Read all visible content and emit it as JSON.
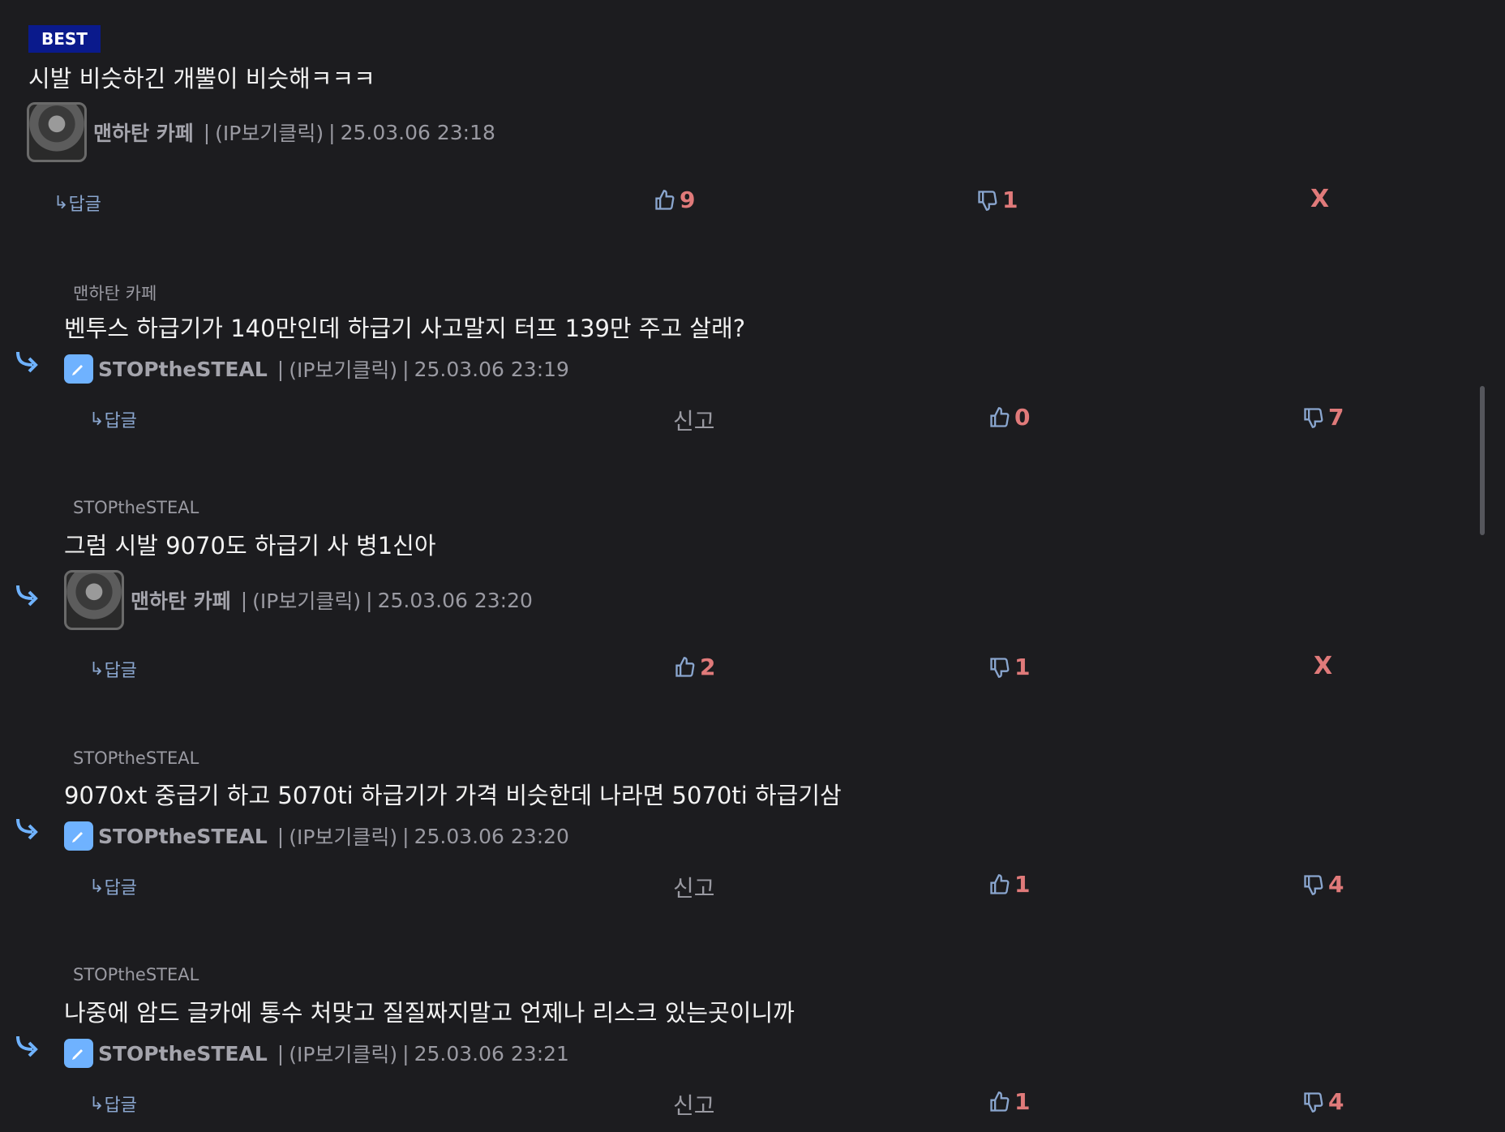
{
  "comments": [
    {
      "badge": "BEST",
      "text": "시발 비슷하긴 개뿔이 비슷해ㅋㅋㅋ",
      "nickname": "맨하탄 카페",
      "ip": "(IP보기클릭)",
      "time": "25.03.06 23:18",
      "reply_label": "답글",
      "likes": "9",
      "dislikes": "1",
      "delete_label": "X"
    },
    {
      "reply_to": "맨하탄 카페",
      "text": "벤투스 하급기가 140만인데 하급기 사고말지 터프 139만 주고 살래?",
      "nickname": "STOPtheSTEAL",
      "ip": "(IP보기클릭)",
      "time": "25.03.06 23:19",
      "reply_label": "답글",
      "report_label": "신고",
      "likes": "0",
      "dislikes": "7"
    },
    {
      "reply_to": "STOPtheSTEAL",
      "text": "그럼 시발 9070도 하급기 사 병1신아",
      "nickname": "맨하탄 카페",
      "ip": "(IP보기클릭)",
      "time": "25.03.06 23:20",
      "reply_label": "답글",
      "likes": "2",
      "dislikes": "1",
      "delete_label": "X"
    },
    {
      "reply_to": "STOPtheSTEAL",
      "text": "9070xt 중급기 하고 5070ti 하급기가 가격 비슷한데 나라면 5070ti 하급기삼",
      "nickname": "STOPtheSTEAL",
      "ip": "(IP보기클릭)",
      "time": "25.03.06 23:20",
      "reply_label": "답글",
      "report_label": "신고",
      "likes": "1",
      "dislikes": "4"
    },
    {
      "reply_to": "STOPtheSTEAL",
      "text": "나중에 암드 글카에 통수 처맞고 질질짜지말고 언제나 리스크 있는곳이니까",
      "nickname": "STOPtheSTEAL",
      "ip": "(IP보기클릭)",
      "time": "25.03.06 23:21",
      "reply_label": "답글",
      "report_label": "신고",
      "likes": "1",
      "dislikes": "4"
    }
  ],
  "colors": {
    "background": "#1c1c1f",
    "best_badge": "#0a1a8c",
    "vote_count": "#e07a7a",
    "link": "#8aa6cf",
    "pen_badge": "#6fb2ff"
  }
}
